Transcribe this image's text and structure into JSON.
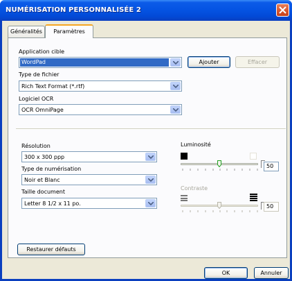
{
  "window": {
    "title": "NUMÉRISATION PERSONNALISÉE 2"
  },
  "tabs": [
    {
      "label": "Généralités",
      "active": false
    },
    {
      "label": "Paramètres",
      "active": true
    }
  ],
  "app_section": {
    "target_app_label": "Application cible",
    "target_app_value": "WordPad",
    "add_button": "Ajouter",
    "delete_button": "Effacer",
    "file_type_label": "Type de fichier",
    "file_type_value": "Rich Text Format (*.rtf)",
    "ocr_label": "Logiciel OCR",
    "ocr_value": "OCR OmniPage"
  },
  "scan_section": {
    "resolution_label": "Résolution",
    "resolution_value": "300 x 300 ppp",
    "scan_type_label": "Type de numérisation",
    "scan_type_value": "Noir et Blanc",
    "doc_size_label": "Taille document",
    "doc_size_value": "Letter 8 1/2 x 11 po."
  },
  "brightness": {
    "label": "Luminosité",
    "value": "50",
    "level": 0.5
  },
  "contrast": {
    "label": "Contraste",
    "value": "50",
    "level": 0.5,
    "enabled": false
  },
  "buttons": {
    "restore_defaults": "Restaurer défauts",
    "ok": "OK",
    "cancel": "Annuler"
  },
  "colors": {
    "title_bar": "#0554e3",
    "selection": "#316ac5",
    "dialog_bg": "#ece9d8",
    "focus_tab": "#f5a623"
  },
  "icons": [
    "close-icon",
    "chevron-down-icon",
    "black-square-icon",
    "white-square-icon",
    "contrast-low-icon",
    "contrast-high-icon"
  ]
}
